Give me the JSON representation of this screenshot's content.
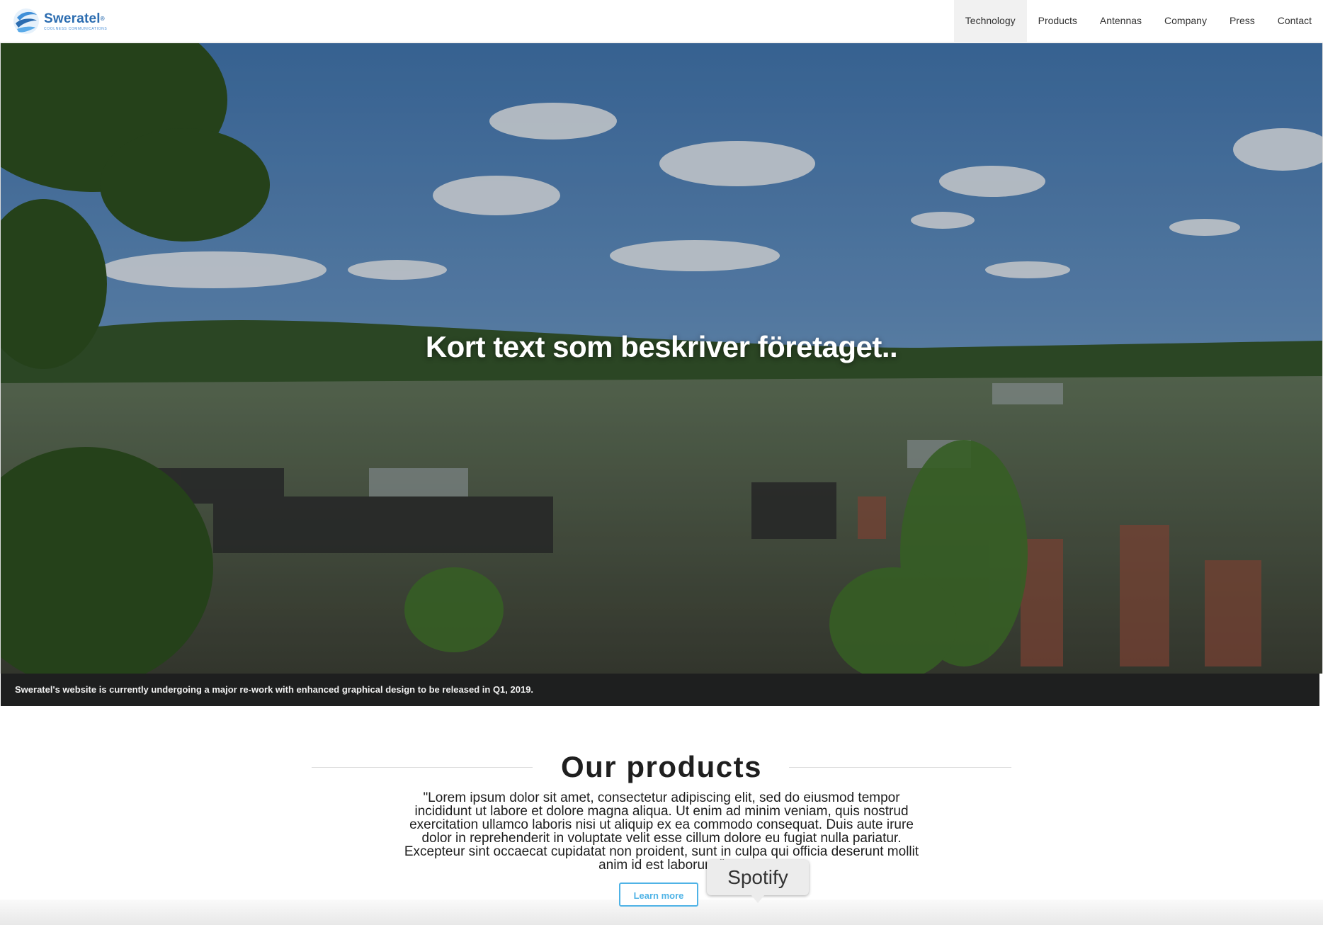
{
  "header": {
    "logo": {
      "name": "Sweratel",
      "registered": "®",
      "tagline": "COOLNESS COMMUNICATIONS"
    },
    "nav": [
      {
        "label": "Technology",
        "active": true
      },
      {
        "label": "Products"
      },
      {
        "label": "Antennas"
      },
      {
        "label": "Company"
      },
      {
        "label": "Press"
      },
      {
        "label": "Contact"
      }
    ]
  },
  "hero": {
    "title": "Kort text som beskriver företaget..",
    "notice": "Sweratel's website is currently undergoing a major re-work with enhanced graphical design to be released in Q1, 2019."
  },
  "products": {
    "title": "Our products",
    "text": "\"Lorem ipsum dolor sit amet, consectetur adipiscing elit, sed do eiusmod tempor incididunt ut labore et dolore magna aliqua. Ut enim ad minim veniam, quis nostrud exercitation ullamco laboris nisi ut aliquip ex ea commodo consequat. Duis aute irure dolor in reprehenderit in voluptate velit esse cillum dolore eu fugiat nulla pariatur. Excepteur sint occaecat cupidatat non proident, sunt in culpa qui officia deserunt mollit anim id est laborum.\"",
    "button": "Learn more"
  },
  "tooltip": {
    "label": "Spotify"
  },
  "colors": {
    "accent": "#4fb3e6",
    "brand": "#2b6cb0",
    "notice_bg": "#1e1f1f"
  }
}
